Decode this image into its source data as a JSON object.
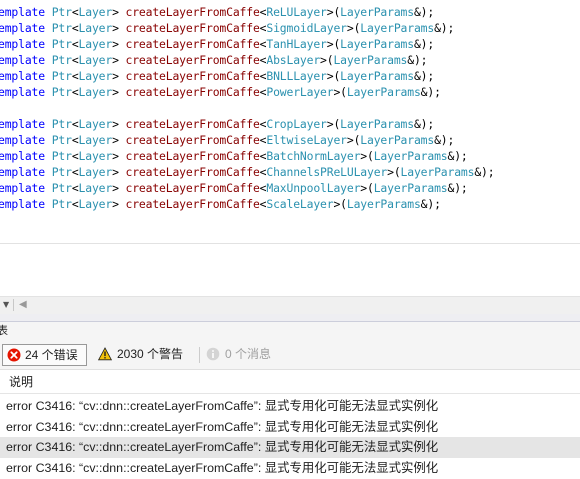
{
  "editor": {
    "groups": [
      [
        {
          "kw": "emplate",
          "type": "Ptr",
          "fn": "createLayerFromCaffe",
          "arg": "ReLULayer",
          "param": "LayerParams"
        },
        {
          "kw": "emplate",
          "type": "Ptr",
          "fn": "createLayerFromCaffe",
          "arg": "SigmoidLayer",
          "param": "LayerParams"
        },
        {
          "kw": "emplate",
          "type": "Ptr",
          "fn": "createLayerFromCaffe",
          "arg": "TanHLayer",
          "param": "LayerParams"
        },
        {
          "kw": "emplate",
          "type": "Ptr",
          "fn": "createLayerFromCaffe",
          "arg": "AbsLayer",
          "param": "LayerParams"
        },
        {
          "kw": "emplate",
          "type": "Ptr",
          "fn": "createLayerFromCaffe",
          "arg": "BNLLLayer",
          "param": "LayerParams"
        },
        {
          "kw": "emplate",
          "type": "Ptr",
          "fn": "createLayerFromCaffe",
          "arg": "PowerLayer",
          "param": "LayerParams"
        }
      ],
      [
        {
          "kw": "emplate",
          "type": "Ptr",
          "fn": "createLayerFromCaffe",
          "arg": "CropLayer",
          "param": "LayerParams"
        },
        {
          "kw": "emplate",
          "type": "Ptr",
          "fn": "createLayerFromCaffe",
          "arg": "EltwiseLayer",
          "param": "LayerParams"
        },
        {
          "kw": "emplate",
          "type": "Ptr",
          "fn": "createLayerFromCaffe",
          "arg": "BatchNormLayer",
          "param": "LayerParams"
        },
        {
          "kw": "emplate",
          "type": "Ptr",
          "fn": "createLayerFromCaffe",
          "arg": "ChannelsPReLULayer",
          "param": "LayerParams"
        },
        {
          "kw": "emplate",
          "type": "Ptr",
          "fn": "createLayerFromCaffe",
          "arg": "MaxUnpoolLayer",
          "param": "LayerParams"
        },
        {
          "kw": "emplate",
          "type": "Ptr",
          "fn": "createLayerFromCaffe",
          "arg": "ScaleLayer",
          "param": "LayerParams"
        }
      ]
    ],
    "template_arg": "Layer"
  },
  "panel": {
    "title": "表",
    "filters": {
      "errors": {
        "label": "24 个错误",
        "icon": "error-icon",
        "color": "#e51400"
      },
      "warnings": {
        "label": "2030 个警告",
        "icon": "warning-icon",
        "color": "#f2c10a"
      },
      "messages": {
        "label": "0 个消息",
        "icon": "info-icon"
      }
    },
    "column_header": "说明",
    "rows": [
      "error C3416: “cv::dnn::createLayerFromCaffe”: 显式专用化可能无法显式实例化",
      "error C3416: “cv::dnn::createLayerFromCaffe”: 显式专用化可能无法显式实例化",
      "error C3416: “cv::dnn::createLayerFromCaffe”: 显式专用化可能无法显式实例化",
      "error C3416: “cv::dnn::createLayerFromCaffe”: 显式专用化可能无法显式实例化"
    ]
  },
  "colors": {
    "keyword": "#0000ff",
    "type": "#2b91af",
    "selection": "#cce8ff"
  }
}
